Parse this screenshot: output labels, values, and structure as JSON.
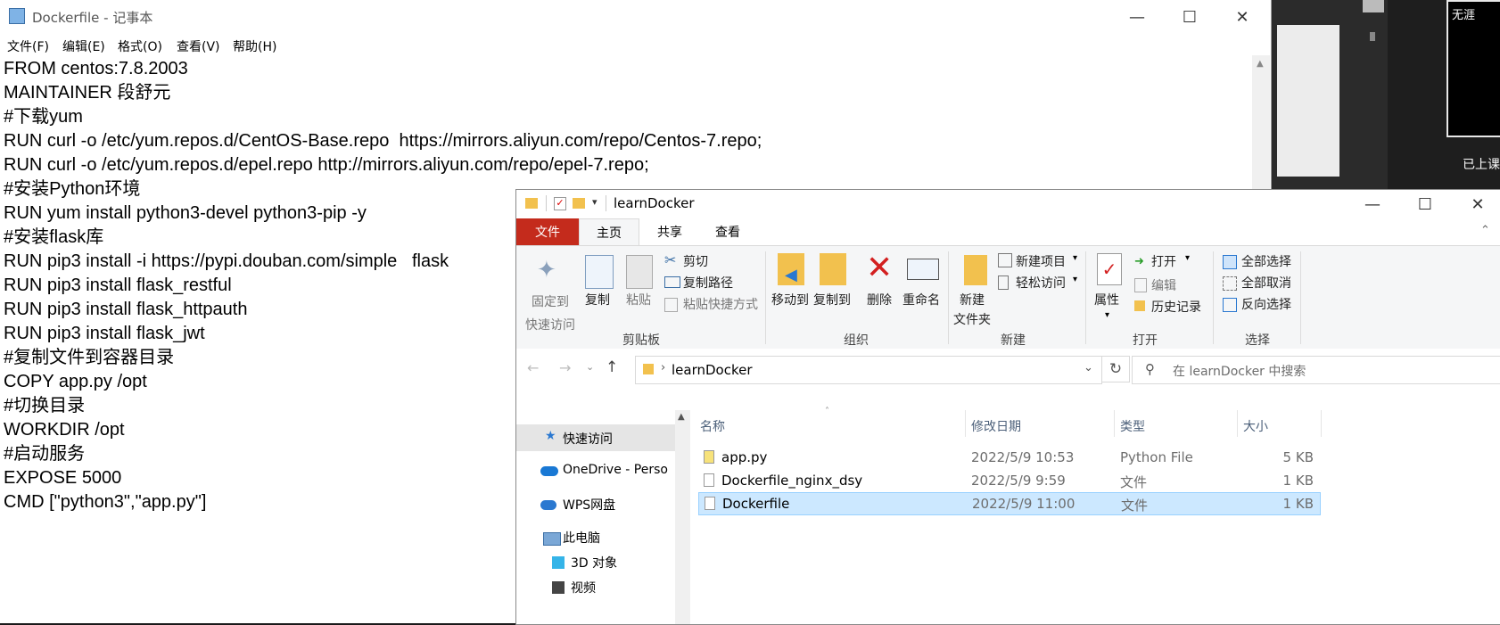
{
  "notepad": {
    "title": "Dockerfile - 记事本",
    "menu": [
      "文件(F)",
      "编辑(E)",
      "格式(O)",
      "查看(V)",
      "帮助(H)"
    ],
    "lines": [
      "FROM centos:7.8.2003",
      "MAINTAINER 段舒元",
      "#下载yum",
      "RUN curl -o /etc/yum.repos.d/CentOS-Base.repo  https://mirrors.aliyun.com/repo/Centos-7.repo;",
      "RUN curl -o /etc/yum.repos.d/epel.repo http://mirrors.aliyun.com/repo/epel-7.repo;",
      "#安装Python环境",
      "RUN yum install python3-devel python3-pip -y",
      "#安装flask库",
      "RUN pip3 install -i https://pypi.douban.com/simple   flask",
      "RUN pip3 install flask_restful",
      "RUN pip3 install flask_httpauth",
      "RUN pip3 install flask_jwt",
      "#复制文件到容器目录",
      "COPY app.py /opt",
      "#切换目录",
      "WORKDIR /opt",
      "#启动服务",
      "EXPOSE 5000",
      "CMD [\"python3\",\"app.py\"]"
    ]
  },
  "side": {
    "box_label": "无涯",
    "status": "已上课"
  },
  "explorer": {
    "title": "learnDocker",
    "tabs": [
      "文件",
      "主页",
      "共享",
      "查看"
    ],
    "ribbon": {
      "pin": "固定到\n快速访问",
      "copy": "复制",
      "paste": "粘贴",
      "cut": "剪切",
      "copy_path": "复制路径",
      "paste_shortcut": "粘贴快捷方式",
      "move_to": "移动到",
      "copy_to": "复制到",
      "delete": "删除",
      "rename": "重命名",
      "new_folder": "新建\n文件夹",
      "new_item": "新建项目",
      "easy_access": "轻松访问",
      "properties": "属性",
      "open": "打开",
      "edit": "编辑",
      "history": "历史记录",
      "select_all": "全部选择",
      "select_none": "全部取消",
      "invert": "反向选择",
      "groups": [
        "剪贴板",
        "组织",
        "新建",
        "打开",
        "选择"
      ]
    },
    "address": "learnDocker",
    "search_placeholder": "在 learnDocker 中搜索",
    "nav": [
      "快速访问",
      "OneDrive - Perso",
      "WPS网盘",
      "此电脑",
      "3D 对象",
      "视频"
    ],
    "columns": [
      "名称",
      "修改日期",
      "类型",
      "大小"
    ],
    "files": [
      {
        "name": "app.py",
        "date": "2022/5/9 10:53",
        "type": "Python File",
        "size": "5 KB"
      },
      {
        "name": "Dockerfile_nginx_dsy",
        "date": "2022/5/9 9:59",
        "type": "文件",
        "size": "1 KB"
      },
      {
        "name": "Dockerfile",
        "date": "2022/5/9 11:00",
        "type": "文件",
        "size": "1 KB"
      }
    ]
  }
}
